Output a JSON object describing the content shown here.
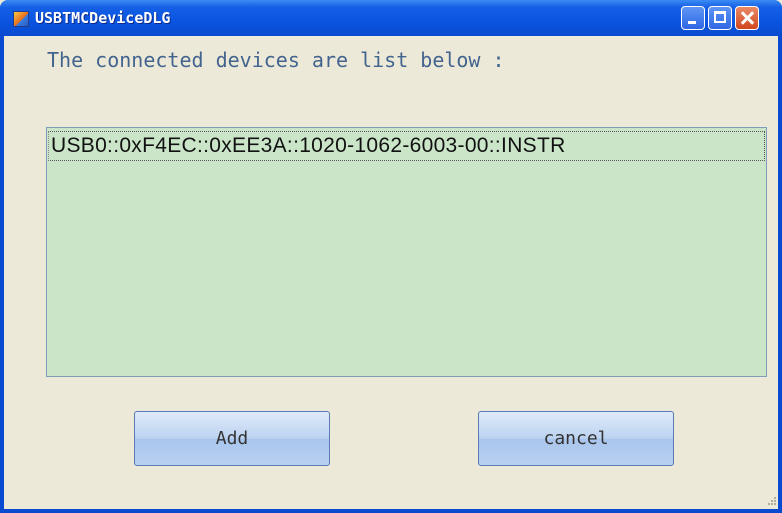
{
  "window": {
    "title": "USBTMCDeviceDLG",
    "controls": {
      "minimize": "minimize-icon",
      "maximize": "maximize-icon",
      "close": "close-icon"
    },
    "colors": {
      "titlebar": "#0a54e0",
      "client": "#ece9d8",
      "listbox": "#cbe5c9",
      "heading": "#43648f"
    }
  },
  "dialog": {
    "heading": "The connected devices are list below :",
    "devices": [
      {
        "label": "USB0::0xF4EC::0xEE3A::1020-1062-6003-00::INSTR"
      }
    ],
    "buttons": {
      "add": "Add",
      "cancel": "cancel"
    }
  }
}
